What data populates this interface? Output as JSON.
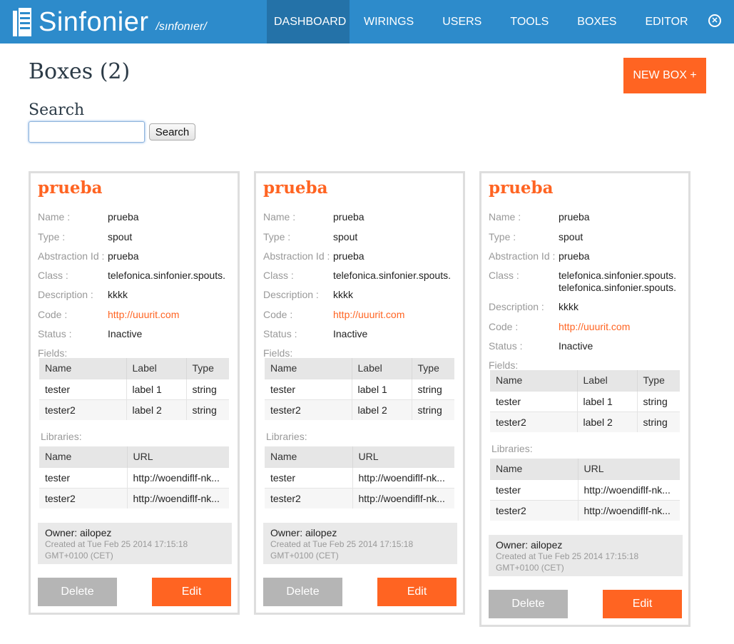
{
  "app": {
    "name": "Sinfonier",
    "tagline": "/sınfonıer/"
  },
  "nav": {
    "items": [
      "DASHBOARD",
      "WIRINGS",
      "USERS",
      "TOOLS",
      "BOXES",
      "EDITOR"
    ],
    "active": "DASHBOARD"
  },
  "page": {
    "title": "Boxes (2)",
    "new_button": "NEW BOX +",
    "search_label": "Search",
    "search_value": "",
    "search_button": "Search"
  },
  "card_labels": {
    "name": "Name :",
    "type": "Type :",
    "abstraction": "Abstraction Id :",
    "class": "Class :",
    "description": "Description :",
    "code": "Code :",
    "status": "Status :",
    "fields": "Fields:",
    "libraries": "Libraries:",
    "fields_headers": [
      "Name",
      "Label",
      "Type"
    ],
    "libraries_headers": [
      "Name",
      "URL"
    ],
    "delete": "Delete",
    "edit": "Edit"
  },
  "cards": [
    {
      "title": "prueba",
      "name": "prueba",
      "type": "spout",
      "abstraction": "prueba",
      "class": "telefonica.sinfonier.spouts.",
      "class2": "",
      "description": "kkkk",
      "code": "http://uuurit.com",
      "status": "Inactive",
      "fields": [
        [
          "tester",
          "label 1",
          "string"
        ],
        [
          "tester2",
          "label 2",
          "string"
        ]
      ],
      "libraries": [
        [
          "tester",
          "http://woendiflf-nk..."
        ],
        [
          "tester2",
          "http://woendiflf-nk..."
        ]
      ],
      "owner": "Owner: ailopez",
      "created": "Created at Tue Feb 25 2014 17:15:18 GMT+0100 (CET)"
    },
    {
      "title": "prueba",
      "name": "prueba",
      "type": "spout",
      "abstraction": "prueba",
      "class": "telefonica.sinfonier.spouts.",
      "class2": "",
      "description": "kkkk",
      "code": "http://uuurit.com",
      "status": "Inactive",
      "fields": [
        [
          "tester",
          "label 1",
          "string"
        ],
        [
          "tester2",
          "label 2",
          "string"
        ]
      ],
      "libraries": [
        [
          "tester",
          "http://woendiflf-nk..."
        ],
        [
          "tester2",
          "http://woendiflf-nk..."
        ]
      ],
      "owner": "Owner: ailopez",
      "created": "Created at Tue Feb 25 2014 17:15:18 GMT+0100 (CET)"
    },
    {
      "title": "prueba",
      "name": "prueba",
      "type": "spout",
      "abstraction": "prueba",
      "class": "telefonica.sinfonier.spouts.",
      "class2": "telefonica.sinfonier.spouts.",
      "description": "kkkk",
      "code": "http://uuurit.com",
      "status": "Inactive",
      "fields": [
        [
          "tester",
          "label 1",
          "string"
        ],
        [
          "tester2",
          "label 2",
          "string"
        ]
      ],
      "libraries": [
        [
          "tester",
          "http://woendiflf-nk..."
        ],
        [
          "tester2",
          "http://woendiflf-nk..."
        ]
      ],
      "owner": "Owner: ailopez",
      "created": "Created at Tue Feb 25 2014 17:15:18 GMT+0100 (CET)"
    }
  ],
  "colors": {
    "brand": "#2d8bcb",
    "accent": "#ff6422",
    "nav_active": "#2472a8"
  }
}
